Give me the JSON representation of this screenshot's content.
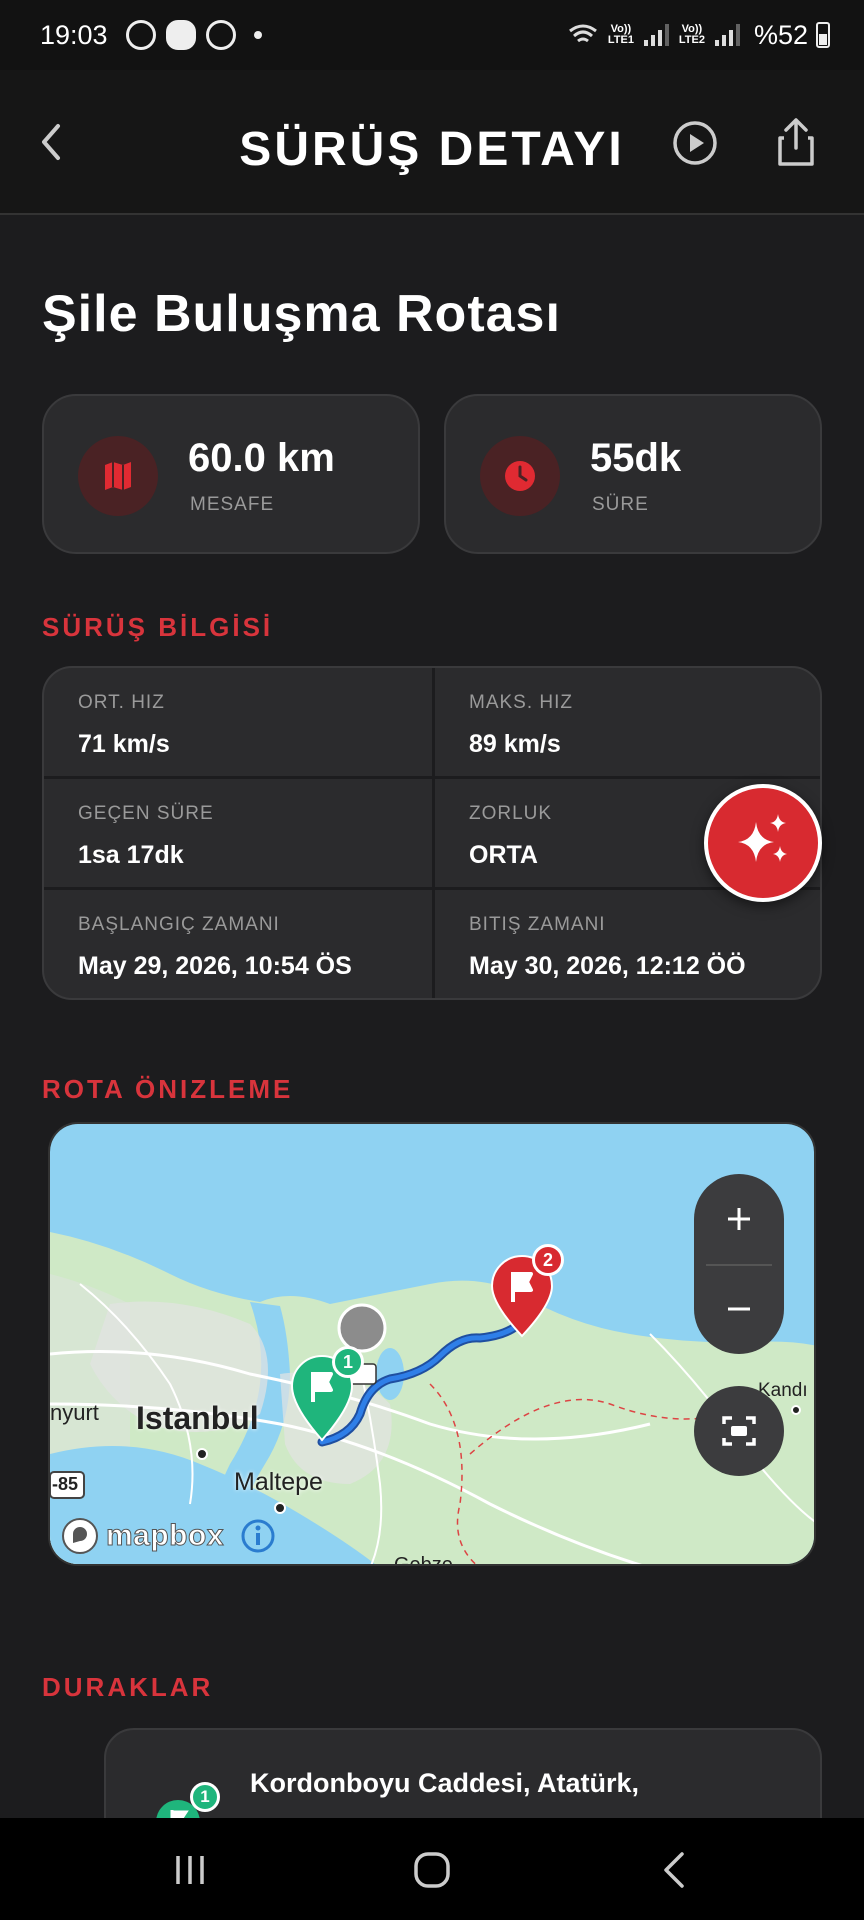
{
  "status_bar": {
    "time": "19:03",
    "battery": "%52",
    "net1": "Vo)) LTE1",
    "net2": "Vo)) LTE2"
  },
  "header": {
    "title": "SÜRÜŞ DETAYI",
    "icons": [
      "chevron-left-icon",
      "play-circle-icon",
      "share-icon"
    ]
  },
  "route": {
    "name": "Şile Buluşma Rotası"
  },
  "stats": {
    "distance_value": "60.0 km",
    "distance_label": "MESAFE",
    "duration_value": "55dk",
    "duration_label": "SÜRE"
  },
  "ride_info": {
    "section_title": "SÜRÜŞ BİLGİSİ",
    "avg_speed_label": "ORT. HIZ",
    "avg_speed_value": "71 km/s",
    "max_speed_label": "MAKS. HIZ",
    "max_speed_value": "89 km/s",
    "elapsed_label": "GEÇEN SÜRE",
    "elapsed_value": "1sa 17dk",
    "difficulty_label": "ZORLUK",
    "difficulty_value": "ORTA",
    "start_label": "BAŞLANGIÇ ZAMANI",
    "start_value": "May 29, 2026, 10:54 ÖS",
    "end_label": "BITIŞ ZAMANI",
    "end_value": "May 30, 2026, 12:12 ÖÖ"
  },
  "route_preview": {
    "section_title": "ROTA ÖNIZLEME",
    "labels": {
      "istanbul": "Istanbul",
      "maltepe": "Maltepe",
      "kandira": "Kandı",
      "nyurt": "nyurt",
      "gebze": "Gebze",
      "road": "-85"
    },
    "markers": [
      "1",
      "2"
    ],
    "attribution": "mapbox"
  },
  "stops": {
    "section_title": "DURAKLAR",
    "items": [
      {
        "number": "1",
        "title": "Kordonboyu Caddesi, Atatürk,"
      }
    ]
  },
  "colors": {
    "accent": "#d8343c",
    "background": "#1c1c1e",
    "card": "#2b2b2d",
    "start_marker": "#1fb57c",
    "end_marker": "#d82a30",
    "route_line": "#1f6fd1"
  }
}
